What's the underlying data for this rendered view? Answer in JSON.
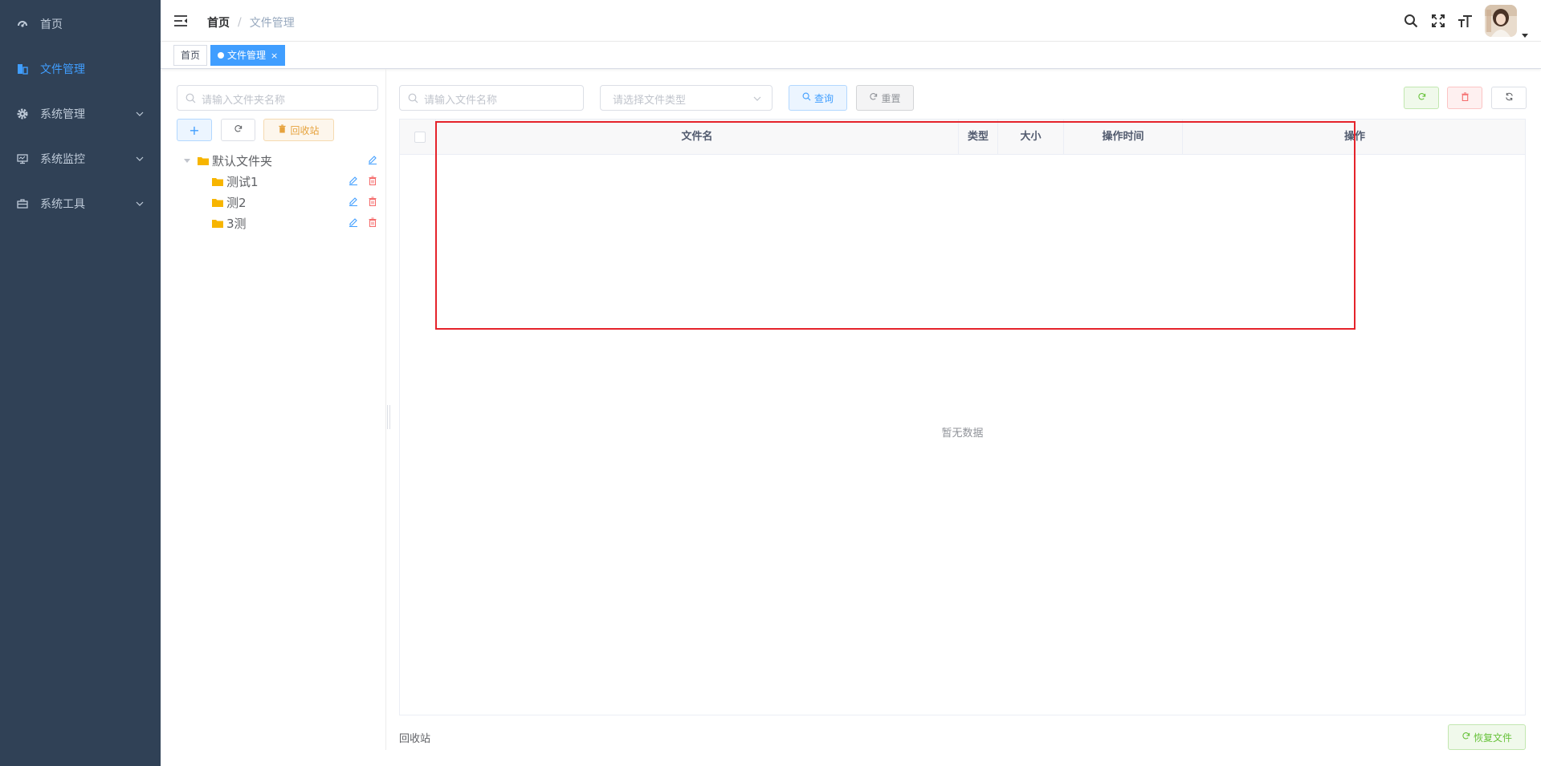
{
  "sidebar": {
    "items": [
      {
        "label": "首页",
        "icon": "dashboard-icon",
        "expandable": false,
        "active": false
      },
      {
        "label": "文件管理",
        "icon": "file-icon",
        "expandable": false,
        "active": true
      },
      {
        "label": "系统管理",
        "icon": "gear-icon",
        "expandable": true,
        "active": false
      },
      {
        "label": "系统监控",
        "icon": "monitor-icon",
        "expandable": true,
        "active": false
      },
      {
        "label": "系统工具",
        "icon": "toolbox-icon",
        "expandable": true,
        "active": false
      }
    ]
  },
  "header": {
    "breadcrumb": {
      "home": "首页",
      "separator": "/",
      "current": "文件管理"
    }
  },
  "tags": [
    {
      "label": "首页",
      "active": false
    },
    {
      "label": "文件管理",
      "active": true,
      "close": "×"
    }
  ],
  "left_panel": {
    "folder_search_placeholder": "请输入文件夹名称",
    "add_label": "+",
    "recycle_label": "回收站",
    "tree": [
      {
        "label": "默认文件夹",
        "level": 0,
        "expanded": true
      },
      {
        "label": "测试1",
        "level": 1
      },
      {
        "label": "测2",
        "level": 1
      },
      {
        "label": "3测",
        "level": 1
      }
    ]
  },
  "toolbar": {
    "file_search_placeholder": "请输入文件名称",
    "type_select_placeholder": "请选择文件类型",
    "query_label": "查询",
    "reset_label": "重置"
  },
  "table": {
    "columns": [
      "文件名",
      "类型",
      "大小",
      "操作时间",
      "操作"
    ],
    "empty_text": "暂无数据"
  },
  "footer": {
    "title": "回收站",
    "restore_label": "恢复文件"
  },
  "colors": {
    "sidebar_bg": "#304156",
    "accent": "#409eff",
    "highlight": "#e5232b"
  }
}
